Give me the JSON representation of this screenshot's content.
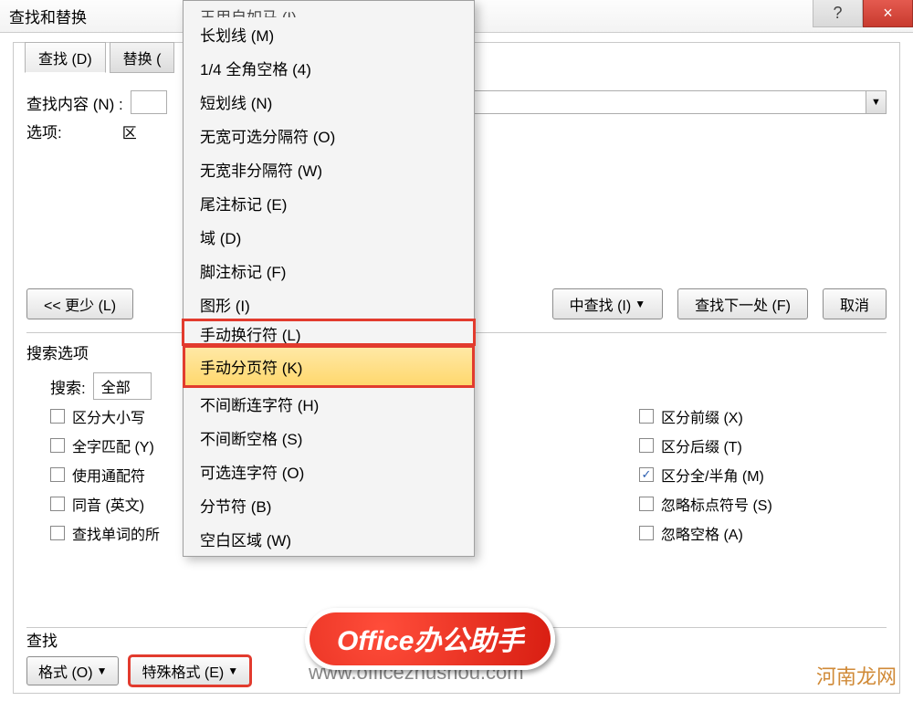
{
  "title": "查找和替换",
  "titlebar": {
    "help": "?",
    "close": "×"
  },
  "tabs": {
    "find": "查找 (D)",
    "replace": "替换 ("
  },
  "labels": {
    "find_what": "查找内容 (N) :",
    "options": "选项:",
    "options_value": "区",
    "search_section": "搜索选项",
    "search": "搜索:",
    "search_value": "全部",
    "bottom": "查找"
  },
  "buttons": {
    "less": "<< 更少 (L)",
    "find_in": "中查找 (I)",
    "find_next": "查找下一处 (F)",
    "cancel": "取消",
    "format": "格式 (O)",
    "special": "特殊格式 (E)"
  },
  "checks_left": [
    "区分大小写",
    "全字匹配 (Y)",
    "使用通配符",
    "同音 (英文)",
    "查找单词的所"
  ],
  "checks_right": [
    {
      "label": "区分前缀 (X)",
      "checked": false
    },
    {
      "label": "区分后缀 (T)",
      "checked": false
    },
    {
      "label": "区分全/半角 (M)",
      "checked": true
    },
    {
      "label": "忽略标点符号 (S)",
      "checked": false
    },
    {
      "label": "忽略空格 (A)",
      "checked": false
    }
  ],
  "menu": [
    "长划线 (M)",
    "1/4 全角空格 (4)",
    "短划线 (N)",
    "无宽可选分隔符 (O)",
    "无宽非分隔符 (W)",
    "尾注标记 (E)",
    "域 (D)",
    "脚注标记 (F)",
    "图形 (I)",
    "手动换行符 (L)",
    "手动分页符 (K)",
    "不间断连字符 (H)",
    "不间断空格 (S)",
    "可选连字符 (O)",
    "分节符 (B)",
    "空白区域 (W)"
  ],
  "menu_top_cut": "王用自如马 (I)",
  "overlay": {
    "pill": "Office办公助手",
    "url": "www.officezhushou.com",
    "corner": "河南龙网"
  }
}
